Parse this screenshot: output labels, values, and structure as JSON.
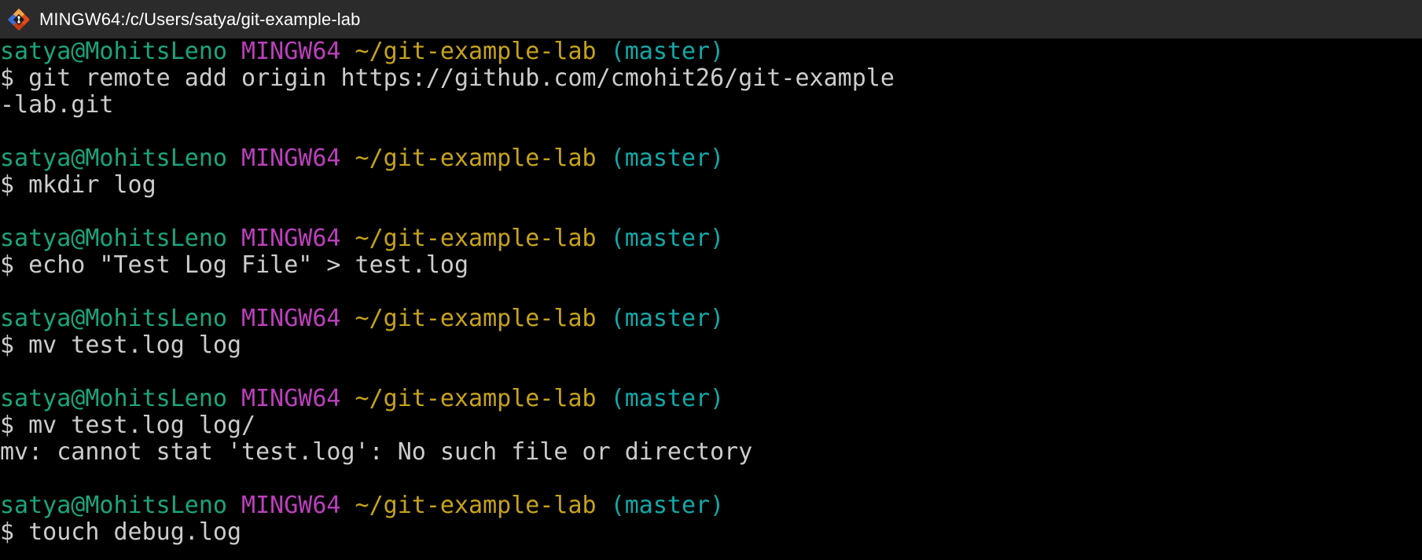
{
  "window": {
    "title": "MINGW64:/c/Users/satya/git-example-lab",
    "icon": "git-bash-icon"
  },
  "terminal": {
    "colors": {
      "background": "#000000",
      "user_host": "#1aa57c",
      "system": "#bc3fbc",
      "path": "#c7a31a",
      "branch": "#11a8a8",
      "text": "#cccccc"
    },
    "blocks": [
      {
        "prompt": {
          "user_host": "satya@MohitsLeno",
          "system": "MINGW64",
          "path": "~/git-example-lab",
          "branch": "(master)"
        },
        "command": "$ git remote add origin https://github.com/cmohit26/git-example",
        "command_cont": "-lab.git",
        "output": ""
      },
      {
        "prompt": {
          "user_host": "satya@MohitsLeno",
          "system": "MINGW64",
          "path": "~/git-example-lab",
          "branch": "(master)"
        },
        "command": "$ mkdir log",
        "command_cont": "",
        "output": ""
      },
      {
        "prompt": {
          "user_host": "satya@MohitsLeno",
          "system": "MINGW64",
          "path": "~/git-example-lab",
          "branch": "(master)"
        },
        "command": "$ echo \"Test Log File\" > test.log",
        "command_cont": "",
        "output": ""
      },
      {
        "prompt": {
          "user_host": "satya@MohitsLeno",
          "system": "MINGW64",
          "path": "~/git-example-lab",
          "branch": "(master)"
        },
        "command": "$ mv test.log log",
        "command_cont": "",
        "output": ""
      },
      {
        "prompt": {
          "user_host": "satya@MohitsLeno",
          "system": "MINGW64",
          "path": "~/git-example-lab",
          "branch": "(master)"
        },
        "command": "$ mv test.log log/",
        "command_cont": "",
        "output": "mv: cannot stat 'test.log': No such file or directory"
      },
      {
        "prompt": {
          "user_host": "satya@MohitsLeno",
          "system": "MINGW64",
          "path": "~/git-example-lab",
          "branch": "(master)"
        },
        "command": "$ touch debug.log",
        "command_cont": "",
        "output": ""
      }
    ]
  }
}
